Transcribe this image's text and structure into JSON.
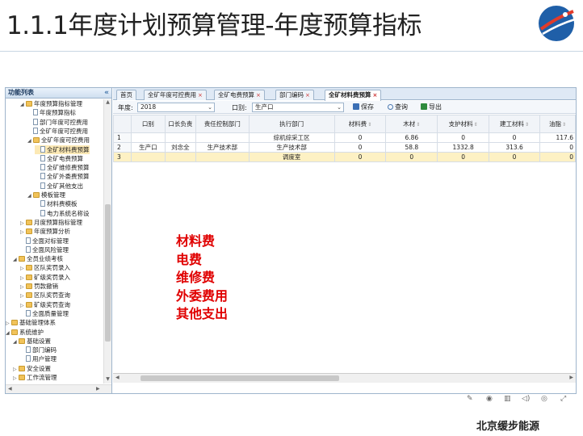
{
  "slide": {
    "title": "1.1.1年度计划预算管理-年度预算指标",
    "brand": "北京缓步能源"
  },
  "sidebar": {
    "title": "功能列表",
    "collapse_icon": "«",
    "items": [
      {
        "label": "年度预算指标管理",
        "type": "folder",
        "level": 2,
        "expanded": true
      },
      {
        "label": "年度预算指标",
        "type": "doc",
        "level": 3
      },
      {
        "label": "部门年度可控费用",
        "type": "doc",
        "level": 3
      },
      {
        "label": "全矿年度可控费用",
        "type": "doc",
        "level": 3
      },
      {
        "label": "全矿年度可控费用",
        "type": "folder",
        "level": 3,
        "expanded": true
      },
      {
        "label": "全矿材料费预算",
        "type": "doc",
        "level": 4,
        "selected": true
      },
      {
        "label": "全矿电费预算",
        "type": "doc",
        "level": 4
      },
      {
        "label": "全矿维修费预算",
        "type": "doc",
        "level": 4
      },
      {
        "label": "全矿外委费预算",
        "type": "doc",
        "level": 4
      },
      {
        "label": "全矿其他支出",
        "type": "doc",
        "level": 4
      },
      {
        "label": "模板管理",
        "type": "folder",
        "level": 3,
        "expanded": true
      },
      {
        "label": "材料费模板",
        "type": "doc",
        "level": 4
      },
      {
        "label": "电力系统名称设",
        "type": "doc",
        "level": 4
      },
      {
        "label": "月度预算指标管理",
        "type": "folder",
        "level": 2,
        "expanded": false
      },
      {
        "label": "年度预算分析",
        "type": "folder",
        "level": 2,
        "expanded": false
      },
      {
        "label": "全面对标管理",
        "type": "doc",
        "level": 2
      },
      {
        "label": "全面风险管理",
        "type": "doc",
        "level": 2
      },
      {
        "label": "全员业绩考核",
        "type": "folder",
        "level": 1,
        "expanded": true
      },
      {
        "label": "区队奖罚录入",
        "type": "folder",
        "level": 2,
        "expanded": false
      },
      {
        "label": "矿级奖罚录入",
        "type": "folder",
        "level": 2,
        "expanded": false
      },
      {
        "label": "罚款撤销",
        "type": "folder",
        "level": 2,
        "expanded": false
      },
      {
        "label": "区队奖罚查询",
        "type": "folder",
        "level": 2,
        "expanded": false
      },
      {
        "label": "矿级奖罚查询",
        "type": "folder",
        "level": 2,
        "expanded": false
      },
      {
        "label": "全面质量管理",
        "type": "doc",
        "level": 2
      },
      {
        "label": "基础管理体系",
        "type": "folder",
        "level": 0,
        "expanded": false
      },
      {
        "label": "系统维护",
        "type": "folder",
        "level": 0,
        "expanded": true
      },
      {
        "label": "基础设置",
        "type": "folder",
        "level": 1,
        "expanded": true
      },
      {
        "label": "部门编码",
        "type": "doc",
        "level": 2
      },
      {
        "label": "用户管理",
        "type": "doc",
        "level": 2
      },
      {
        "label": "安全设置",
        "type": "folder",
        "level": 1,
        "expanded": false
      },
      {
        "label": "工作流管理",
        "type": "folder",
        "level": 1,
        "expanded": false
      }
    ]
  },
  "tabs": [
    {
      "label": "首页",
      "closable": false,
      "active": false
    },
    {
      "label": "全矿年度可控费用",
      "closable": true,
      "active": false
    },
    {
      "label": "全矿电费预算",
      "closable": true,
      "active": false
    },
    {
      "label": "部门编码",
      "closable": true,
      "active": false
    },
    {
      "label": "全矿材料费预算",
      "closable": true,
      "active": true
    }
  ],
  "toolbar": {
    "year_label": "年度:",
    "year_value": "2018",
    "dept_label": "口别:",
    "dept_value": "生产口",
    "save_label": "保存",
    "query_label": "查询",
    "export_label": "导出"
  },
  "grid": {
    "columns": [
      "",
      "口别",
      "口长负责",
      "责任控制部门",
      "执行部门",
      "材料费",
      "木材",
      "支护材料",
      "建工材料",
      "油脂"
    ],
    "rows": [
      {
        "rn": "1",
        "cells": [
          "",
          "",
          "",
          "综机综采工区",
          "0",
          "6.86",
          "0",
          "0",
          "117.6"
        ]
      },
      {
        "rn": "2",
        "cells": [
          "生产口",
          "刘念全",
          "生产技术部",
          "生产技术部",
          "0",
          "58.8",
          "1332.8",
          "313.6",
          "0"
        ]
      },
      {
        "rn": "3",
        "cells": [
          "",
          "",
          "",
          "调度室",
          "0",
          "0",
          "0",
          "0",
          "0"
        ],
        "highlight": true
      }
    ]
  },
  "overlay": {
    "lines": [
      "材料费",
      "电费",
      "维修费",
      "外委费用",
      "其他支出"
    ],
    "color": "#e00000"
  },
  "colors": {
    "border": "#9fb5cc",
    "selected_row": "#fdf1c4",
    "tab_bar": "#dfe9f5"
  }
}
